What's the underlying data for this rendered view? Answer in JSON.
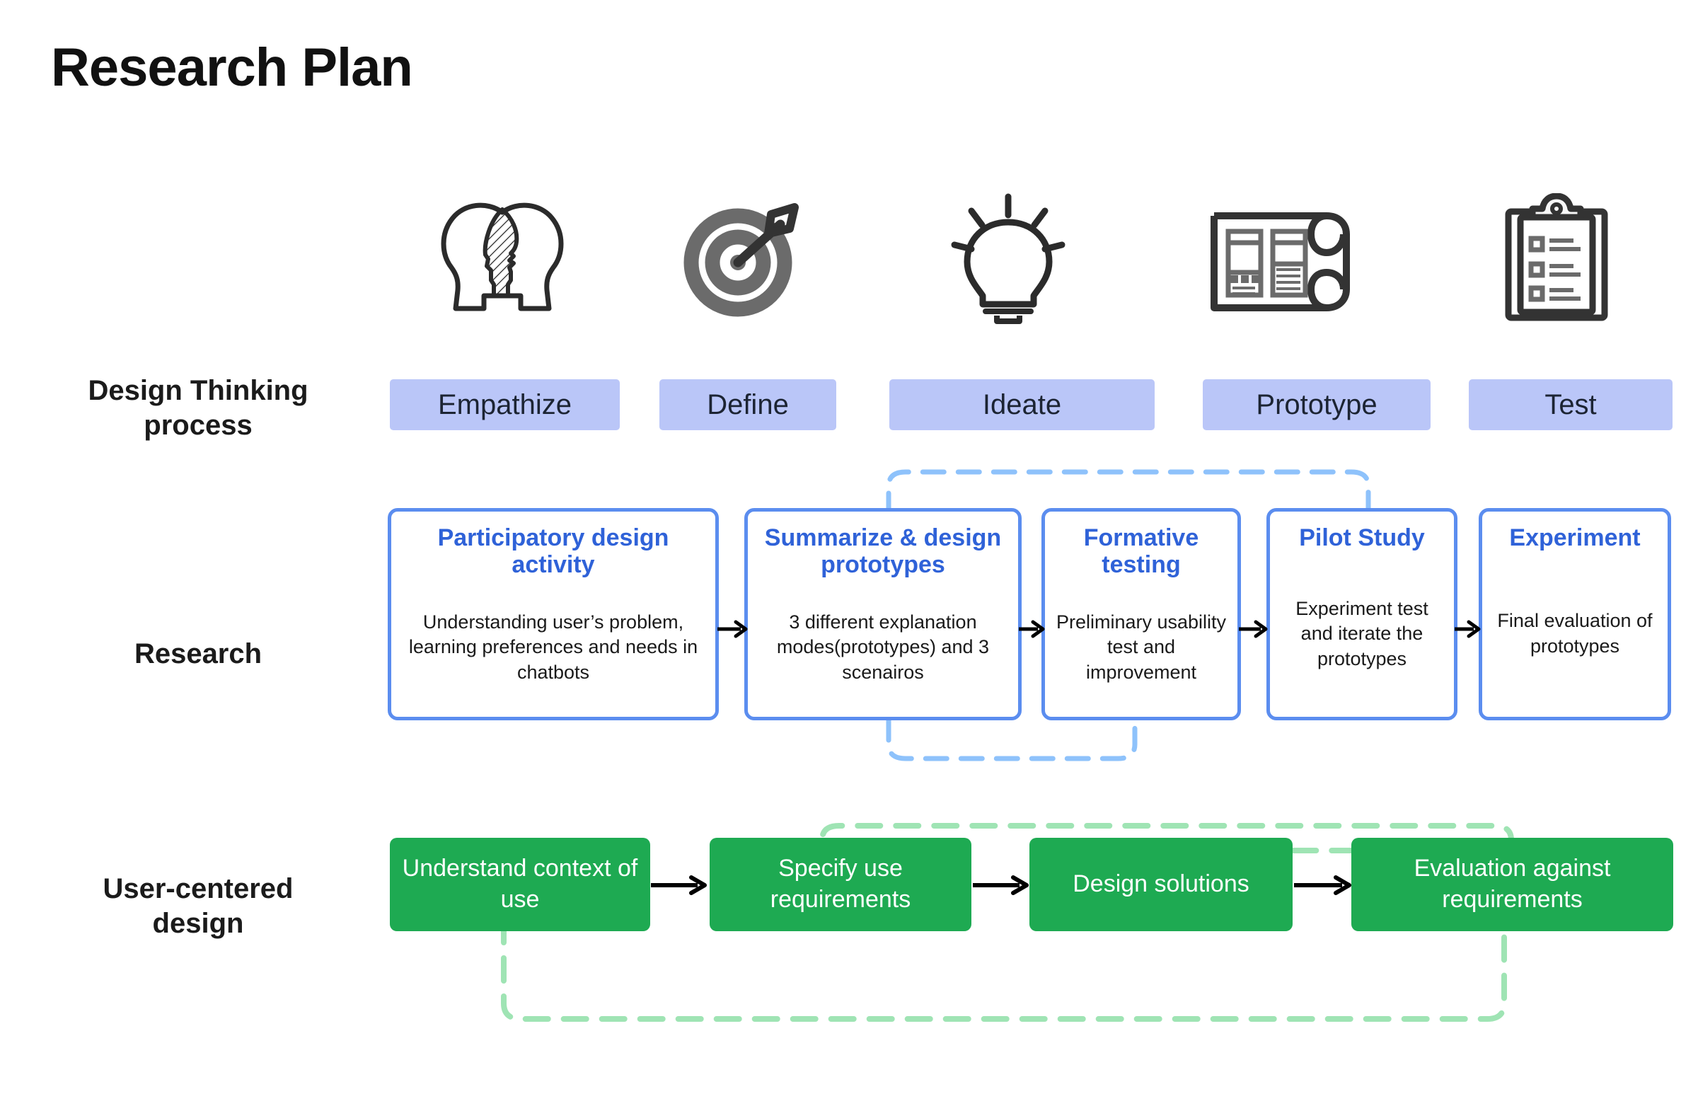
{
  "title": "Research Plan",
  "rows": {
    "design_thinking": {
      "label_line1": "Design Thinking",
      "label_line2": "process"
    },
    "research": {
      "label_line1": "Research",
      "label_line2": ""
    },
    "ucd": {
      "label_line1": "User-centered",
      "label_line2": "design"
    }
  },
  "icons": [
    {
      "name": "two-heads-empathy-icon",
      "for": "Empathize"
    },
    {
      "name": "target-dart-icon",
      "for": "Define"
    },
    {
      "name": "lightbulb-icon",
      "for": "Ideate"
    },
    {
      "name": "blueprint-wireframe-icon",
      "for": "Prototype"
    },
    {
      "name": "clipboard-checklist-icon",
      "for": "Test"
    }
  ],
  "design_thinking_stages": [
    {
      "label": "Empathize"
    },
    {
      "label": "Define"
    },
    {
      "label": "Ideate"
    },
    {
      "label": "Prototype"
    },
    {
      "label": "Test"
    }
  ],
  "research_steps": [
    {
      "title": "Participatory design activity",
      "desc": "Understanding user’s problem, learning preferences and needs in chatbots"
    },
    {
      "title": "Summarize & design prototypes",
      "desc": "3 different explanation modes(prototypes) and 3 scenairos"
    },
    {
      "title": "Formative testing",
      "desc": "Preliminary usability test and improvement"
    },
    {
      "title": "Pilot Study",
      "desc": "Experiment test and iterate the prototypes"
    },
    {
      "title": "Experiment",
      "desc": "Final evaluation of prototypes"
    }
  ],
  "ucd_steps": [
    {
      "label": "Understand context of use"
    },
    {
      "label": "Specify use requirements"
    },
    {
      "label": "Design solutions"
    },
    {
      "label": "Evaluation against requirements"
    }
  ],
  "iteration_loops": [
    {
      "name": "research-iteration-loop-top",
      "color": "#8ec2fb",
      "style": "dashed",
      "spans": "Summarize & design prototypes → Pilot Study"
    },
    {
      "name": "research-iteration-loop-bottom",
      "color": "#8ec2fb",
      "style": "dashed",
      "spans": "Summarize & design prototypes → Formative testing"
    },
    {
      "name": "ucd-iteration-loop-top-wide",
      "color": "#9fe4b4",
      "style": "dashed",
      "spans": "Specify use requirements → Evaluation against requirements"
    },
    {
      "name": "ucd-iteration-loop-top-narrow",
      "color": "#9fe4b4",
      "style": "dashed",
      "spans": "Design solutions → Evaluation against requirements"
    },
    {
      "name": "ucd-iteration-loop-bottom",
      "color": "#9fe4b4",
      "style": "dashed",
      "spans": "Understand context of use → Evaluation against requirements"
    }
  ],
  "colors": {
    "pill_bg": "#bac6f8",
    "pill_text": "#1c2433",
    "research_border": "#5b8def",
    "research_title": "#2f62d8",
    "green_box": "#1eaa52",
    "loop_blue": "#8ec2fb",
    "loop_green": "#9fe4b4",
    "arrow": "#000000",
    "text_dark": "#111111"
  }
}
